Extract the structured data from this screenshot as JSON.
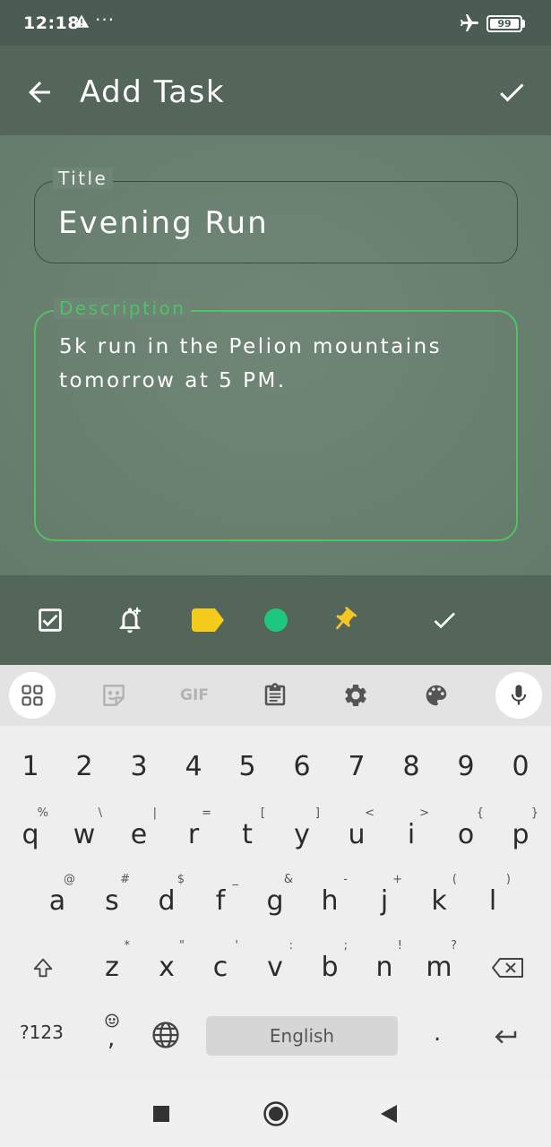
{
  "status_bar": {
    "time": "12:18",
    "more_indicator": "···",
    "battery": "99",
    "icons": [
      "warning-icon",
      "airplane-icon",
      "battery-icon"
    ]
  },
  "app_bar": {
    "title": "Add Task",
    "back_icon": "arrow-back-icon",
    "confirm_icon": "check-icon"
  },
  "form": {
    "title_label": "Title",
    "title_value": "Evening Run",
    "description_label": "Description",
    "description_value": "5k run in the Pelion mountains tomorrow at 5 PM."
  },
  "toolbar": {
    "items": [
      "checkbox-icon",
      "add-alarm-icon",
      "label-icon",
      "color-dot-icon",
      "pin-icon",
      "check-icon"
    ],
    "colors": {
      "label": "#f5cc1b",
      "dot": "#1fc77e",
      "pin": "#f3c623"
    }
  },
  "keyboard": {
    "toolbar": {
      "gif_label": "GIF",
      "items": [
        "apps-grid-icon",
        "sticker-icon",
        "gif-icon",
        "clipboard-icon",
        "settings-gear-icon",
        "palette-icon",
        "microphone-icon"
      ]
    },
    "number_row": [
      "1",
      "2",
      "3",
      "4",
      "5",
      "6",
      "7",
      "8",
      "9",
      "0"
    ],
    "row1": [
      {
        "k": "q",
        "a": "%"
      },
      {
        "k": "w",
        "a": "\\"
      },
      {
        "k": "e",
        "a": "|"
      },
      {
        "k": "r",
        "a": "="
      },
      {
        "k": "t",
        "a": "["
      },
      {
        "k": "y",
        "a": "]"
      },
      {
        "k": "u",
        "a": "<"
      },
      {
        "k": "i",
        "a": ">"
      },
      {
        "k": "o",
        "a": "{"
      },
      {
        "k": "p",
        "a": "}"
      }
    ],
    "row2": [
      {
        "k": "a",
        "a": "@"
      },
      {
        "k": "s",
        "a": "#"
      },
      {
        "k": "d",
        "a": "$"
      },
      {
        "k": "f",
        "a": "_"
      },
      {
        "k": "g",
        "a": "&"
      },
      {
        "k": "h",
        "a": "-"
      },
      {
        "k": "j",
        "a": "+"
      },
      {
        "k": "k",
        "a": "("
      },
      {
        "k": "l",
        "a": ")"
      }
    ],
    "row3": [
      {
        "k": "z",
        "a": "*"
      },
      {
        "k": "x",
        "a": "\""
      },
      {
        "k": "c",
        "a": "'"
      },
      {
        "k": "v",
        "a": ":"
      },
      {
        "k": "b",
        "a": ";"
      },
      {
        "k": "n",
        "a": "!"
      },
      {
        "k": "m",
        "a": "?"
      }
    ],
    "symbols_label": "?123",
    "comma": ",",
    "period": ".",
    "space_label": "English"
  },
  "nav_bar": {
    "items": [
      "recents-square-icon",
      "home-circle-icon",
      "back-triangle-icon"
    ]
  }
}
